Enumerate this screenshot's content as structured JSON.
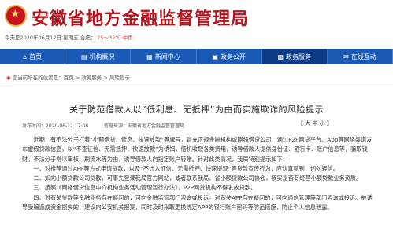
{
  "header": {
    "site_title": "安徽省地方金融监督管理局",
    "date_line": "今天是2020年06月12日 星期五 合肥：",
    "temperature": "25～32℃ 中雨"
  },
  "nav": [
    {
      "icon": "home-icon",
      "glyph": "⌂",
      "label": "首页"
    },
    {
      "icon": "org-icon",
      "glyph": "▤",
      "label": "机构概况"
    },
    {
      "icon": "news-icon",
      "glyph": "▦",
      "label": "新闻中心"
    },
    {
      "icon": "gov-icon",
      "glyph": "▣",
      "label": "政务公开"
    },
    {
      "icon": "service-icon",
      "glyph": "▩",
      "label": "政务服务"
    },
    {
      "icon": "interact-icon",
      "glyph": "✉",
      "label": "在线互动"
    }
  ],
  "breadcrumb": "您当前所在的位置是：首页 > 政务服务 > 风险提示",
  "article": {
    "title": "关于防范借款人以“低利息、无抵押”为由而实施欺诈的风险提示",
    "date": "发布时间：2020-06-12 17:08",
    "source": "信息来源：安徽省地方金融监督管理局",
    "font_size": "【 大 中 小 】",
    "paragraphs": [
      "近期，有不法分子打着“小额借贷、低息、快速放款”等旗号，冒充正规金融机构或网络借贷公司，通过P2P网贷平台、App等网络渠道发布虚假贷款信息，以“不查征信、无需抵押、快速放款”为诱饵，借机收取各类费用，诱导借款人提供身份证、银行卡、账户信息等，骗取钱财。不法分子常以审核、刷流水等为由，诱导借款人向指定账户转账。针对此类情况，我局特别提示如下：",
      "一、对推荐通过APP等方式申请贷款，以及“不计入征信、无需抵押、快速提现”等贷款宣传行为，应认真甄别，切勿轻信。",
      "二、如向小额贷款公司贷款，可事先登录我局官方网站，或者联系我局、省小额贷款公司协会，核实是否有经营小额贷款业务资质。",
      "三、按照《网络借贷信息中介机构业务活动管理暂行办法》，P2P网贷机构不得发放贷款。",
      "四、对有关贷款等金融业务存在疑问的，可向金融监管部门咨询或投诉。对有关APP存在疑问的，可向通信管理等部门咨询或投诉。被诱导受骗造成资金损失的，建议向公安机关报案，同时及时采取更换绑定APP的银行账户密码等防范措施，防止个人信息泄露。"
    ]
  }
}
